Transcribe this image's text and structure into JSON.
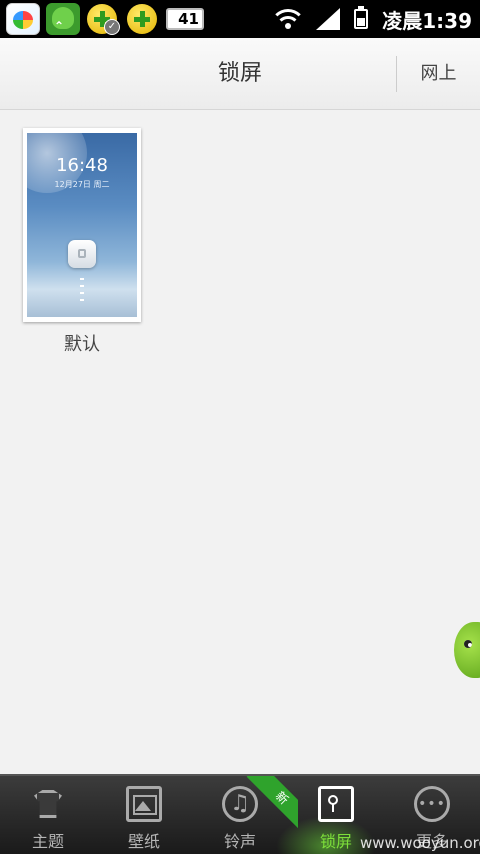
{
  "status_bar": {
    "app_icons": [
      "color-swirl-app-icon",
      "frog-update-icon",
      "plus-check-icon",
      "plus-icon"
    ],
    "box_badge": "41",
    "time": "凌晨1:39"
  },
  "header": {
    "title": "锁屏",
    "online_button": "网上"
  },
  "lockscreen_items": [
    {
      "preview_time": "16:48",
      "preview_date": "12月27日 周二",
      "label": "默认"
    }
  ],
  "bottom_nav": {
    "items": [
      {
        "label": "主题",
        "icon": "shirt-icon"
      },
      {
        "label": "壁纸",
        "icon": "picture-icon"
      },
      {
        "label": "铃声",
        "icon": "music-note-icon"
      },
      {
        "label": "锁屏",
        "icon": "lock-icon"
      },
      {
        "label": "更多",
        "icon": "more-icon"
      }
    ],
    "active_index": 3,
    "new_badge": "新"
  },
  "watermark": "www.wooyun.org",
  "colors": {
    "accent_green": "#7ddf3a",
    "badge_green": "#2fa32c"
  }
}
